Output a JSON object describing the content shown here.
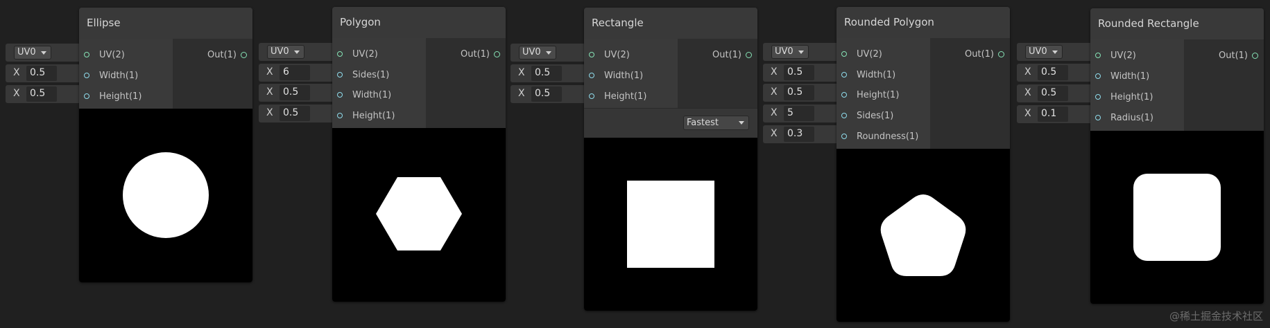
{
  "nodes": [
    {
      "title": "Ellipse",
      "inputs": [
        "UV(2)",
        "Width(1)",
        "Height(1)"
      ],
      "output": "Out(1)",
      "stubs": [
        {
          "type": "uv",
          "value": "UV0"
        },
        {
          "type": "x",
          "label": "X",
          "value": "0.5"
        },
        {
          "type": "x",
          "label": "X",
          "value": "0.5"
        }
      ],
      "shape": "circle"
    },
    {
      "title": "Polygon",
      "inputs": [
        "UV(2)",
        "Sides(1)",
        "Width(1)",
        "Height(1)"
      ],
      "output": "Out(1)",
      "stubs": [
        {
          "type": "uv",
          "value": "UV0"
        },
        {
          "type": "x",
          "label": "X",
          "value": "6"
        },
        {
          "type": "x",
          "label": "X",
          "value": "0.5"
        },
        {
          "type": "x",
          "label": "X",
          "value": "0.5"
        }
      ],
      "shape": "hexagon"
    },
    {
      "title": "Rectangle",
      "inputs": [
        "UV(2)",
        "Width(1)",
        "Height(1)"
      ],
      "output": "Out(1)",
      "stubs": [
        {
          "type": "uv",
          "value": "UV0"
        },
        {
          "type": "x",
          "label": "X",
          "value": "0.5"
        },
        {
          "type": "x",
          "label": "X",
          "value": "0.5"
        }
      ],
      "dropdown": "Fastest",
      "shape": "square"
    },
    {
      "title": "Rounded Polygon",
      "inputs": [
        "UV(2)",
        "Width(1)",
        "Height(1)",
        "Sides(1)",
        "Roundness(1)"
      ],
      "output": "Out(1)",
      "stubs": [
        {
          "type": "uv",
          "value": "UV0"
        },
        {
          "type": "x",
          "label": "X",
          "value": "0.5"
        },
        {
          "type": "x",
          "label": "X",
          "value": "0.5"
        },
        {
          "type": "x",
          "label": "X",
          "value": "5"
        },
        {
          "type": "x",
          "label": "X",
          "value": "0.3"
        }
      ],
      "shape": "pentagon"
    },
    {
      "title": "Rounded Rectangle",
      "inputs": [
        "UV(2)",
        "Width(1)",
        "Height(1)",
        "Radius(1)"
      ],
      "output": "Out(1)",
      "stubs": [
        {
          "type": "uv",
          "value": "UV0"
        },
        {
          "type": "x",
          "label": "X",
          "value": "0.5"
        },
        {
          "type": "x",
          "label": "X",
          "value": "0.5"
        },
        {
          "type": "x",
          "label": "X",
          "value": "0.1"
        }
      ],
      "shape": "rounded-square"
    }
  ],
  "watermark": "@稀土掘金技术社区",
  "colors": {
    "background": "#202020",
    "port_uv": "#86e3b6",
    "port_float": "#8fdcec",
    "preview_bg": "#000000",
    "shape_fill": "#ffffff"
  }
}
